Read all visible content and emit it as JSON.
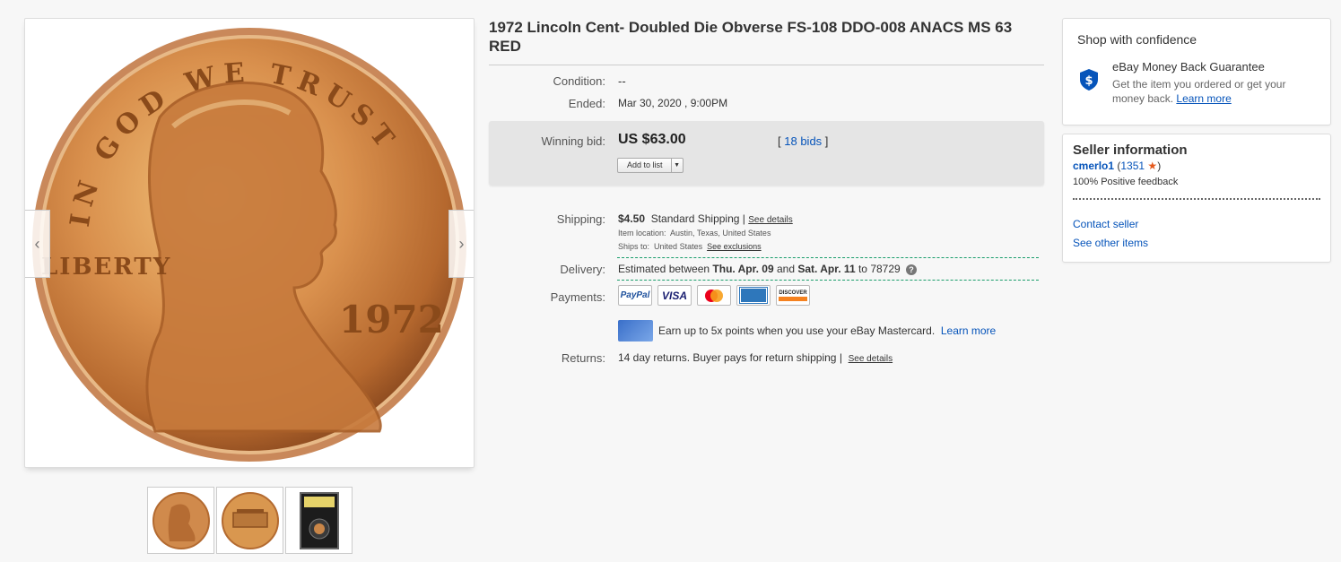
{
  "listing": {
    "title": "1972 Lincoln Cent- Doubled Die Obverse FS-108 DDO-008 ANACS MS 63 RED"
  },
  "condition": {
    "label": "Condition:",
    "value": "--"
  },
  "ended": {
    "label": "Ended:",
    "value": "Mar 30, 2020 , 9:00PM"
  },
  "bid": {
    "label": "Winning bid:",
    "price": "US $63.00",
    "bids_open": "[",
    "bids_link": "18 bids",
    "bids_close": "]",
    "add_to_list": "Add to list"
  },
  "shipping": {
    "label": "Shipping:",
    "cost": "$4.50",
    "method": "Standard Shipping",
    "sep": "|",
    "details_link": "See details",
    "location_label": "Item location:",
    "location": "Austin, Texas, United States",
    "ships_to_label": "Ships to:",
    "ships_to": "United States",
    "exclusions_link": "See exclusions"
  },
  "delivery": {
    "label": "Delivery:",
    "prefix": "Estimated between",
    "from": "Thu. Apr. 09",
    "and": "and",
    "to": "Sat. Apr. 11",
    "zip_prefix": "to",
    "zip": "78729"
  },
  "payments": {
    "label": "Payments:",
    "methods": [
      "PayPal",
      "VISA",
      "Mastercard",
      "American Express",
      "DISCOVER"
    ],
    "promo_text": "Earn up to 5x points when you use your eBay Mastercard.",
    "promo_link": "Learn more"
  },
  "returns": {
    "label": "Returns:",
    "text": "14 day returns. Buyer pays for return shipping",
    "sep": "|",
    "details_link": "See details"
  },
  "confidence": {
    "heading": "Shop with confidence",
    "guarantee_title": "eBay Money Back Guarantee",
    "guarantee_text": "Get the item you ordered or get your money back.",
    "learn_more": "Learn more",
    "icon": "shield-dollar-icon"
  },
  "seller": {
    "heading": "Seller information",
    "name": "cmerlo1",
    "feedback_open": "(",
    "feedback_score": "1351",
    "feedback_close": ")",
    "positive": "100% Positive feedback",
    "contact_link": "Contact seller",
    "other_items_link": "See other items"
  },
  "gallery": {
    "coin_legend_top": "IN GOD WE TRUST",
    "coin_legend_left": "LIBERTY",
    "coin_date": "1972",
    "thumbnails": [
      "obverse-thumbnail",
      "reverse-thumbnail",
      "slab-thumbnail"
    ]
  },
  "colors": {
    "link": "#0654ba",
    "price_box": "#e5e5e5",
    "shield": "#0654ba",
    "star": "#e5591c",
    "dash": "#1a9d6b"
  }
}
